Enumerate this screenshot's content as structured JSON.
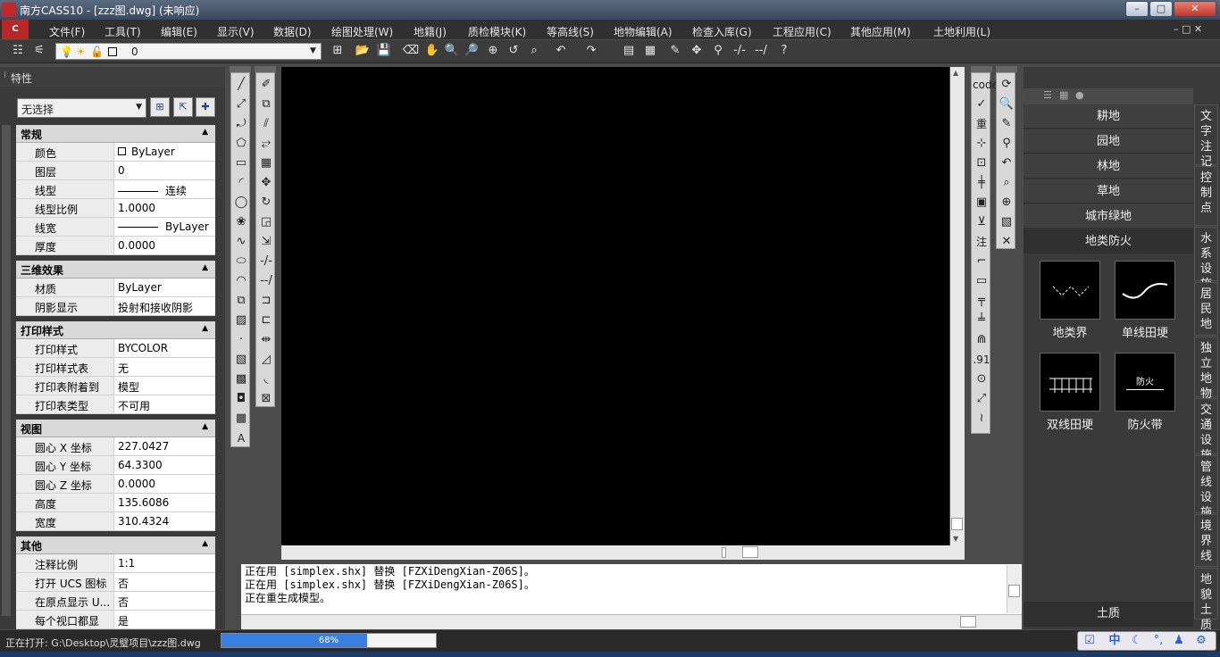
{
  "window": {
    "title": "南方CASS10 - [zzz图.dwg] (未响应)"
  },
  "menu": [
    "文件(F)",
    "工具(T)",
    "编辑(E)",
    "显示(V)",
    "数据(D)",
    "绘图处理(W)",
    "地籍(J)",
    "质检模块(K)",
    "等高线(S)",
    "地物编辑(A)",
    "检查入库(G)",
    "工程应用(C)",
    "其他应用(M)",
    "土地利用(L)"
  ],
  "layer": {
    "value": "0"
  },
  "properties": {
    "header": "特性",
    "selection": "无选择",
    "sections": [
      {
        "title": "常规",
        "rows": [
          [
            "颜色",
            "ByLayer"
          ],
          [
            "图层",
            "0"
          ],
          [
            "线型",
            "连续"
          ],
          [
            "线型比例",
            "1.0000"
          ],
          [
            "线宽",
            "ByLayer"
          ],
          [
            "厚度",
            "0.0000"
          ]
        ]
      },
      {
        "title": "三维效果",
        "rows": [
          [
            "材质",
            "ByLayer"
          ],
          [
            "阴影显示",
            "投射和接收阴影"
          ]
        ]
      },
      {
        "title": "打印样式",
        "rows": [
          [
            "打印样式",
            "BYCOLOR"
          ],
          [
            "打印样式表",
            "无"
          ],
          [
            "打印表附着到",
            "模型"
          ],
          [
            "打印表类型",
            "不可用"
          ]
        ]
      },
      {
        "title": "视图",
        "rows": [
          [
            "圆心 X 坐标",
            "227.0427"
          ],
          [
            "圆心 Y 坐标",
            "64.3300"
          ],
          [
            "圆心 Z 坐标",
            "0.0000"
          ],
          [
            "高度",
            "135.6086"
          ],
          [
            "宽度",
            "310.4324"
          ]
        ]
      },
      {
        "title": "其他",
        "rows": [
          [
            "注释比例",
            "1:1"
          ],
          [
            "打开 UCS 图标",
            "否"
          ],
          [
            "在原点显示 U...",
            "否"
          ],
          [
            "每个视口都显",
            "是"
          ]
        ]
      }
    ]
  },
  "command": {
    "lines": [
      "正在用 [simplex.shx] 替换 [FZXiDengXian-Z06S]。",
      "正在用 [simplex.shx] 替换 [FZXiDengXian-Z06S]。",
      "正在重生成模型。"
    ]
  },
  "status": {
    "text": "正在打开: G:\\Desktop\\灵璧项目\\zzz图.dwg",
    "progress": 0.68,
    "progress_label": "68%"
  },
  "ime": {
    "label": "中"
  },
  "right_panel": {
    "categories": [
      "耕地",
      "园地",
      "林地",
      "草地",
      "城市绿地",
      "地类防火"
    ],
    "symbols": [
      {
        "label": "地类界"
      },
      {
        "label": "单线田埂"
      },
      {
        "label": "双线田埂"
      },
      {
        "label": "防火带",
        "inner": "防火"
      }
    ],
    "bottom": "土质",
    "vtabs": [
      "文字注记",
      "控制点",
      "水系设施",
      "居民地",
      "独立地物",
      "交通设施",
      "管线设施",
      "境界线",
      "地貌土质"
    ]
  },
  "toolbars": {
    "right_labels": [
      "code",
      "重",
      "注",
      ".91"
    ],
    "left_text_tool": "A"
  }
}
